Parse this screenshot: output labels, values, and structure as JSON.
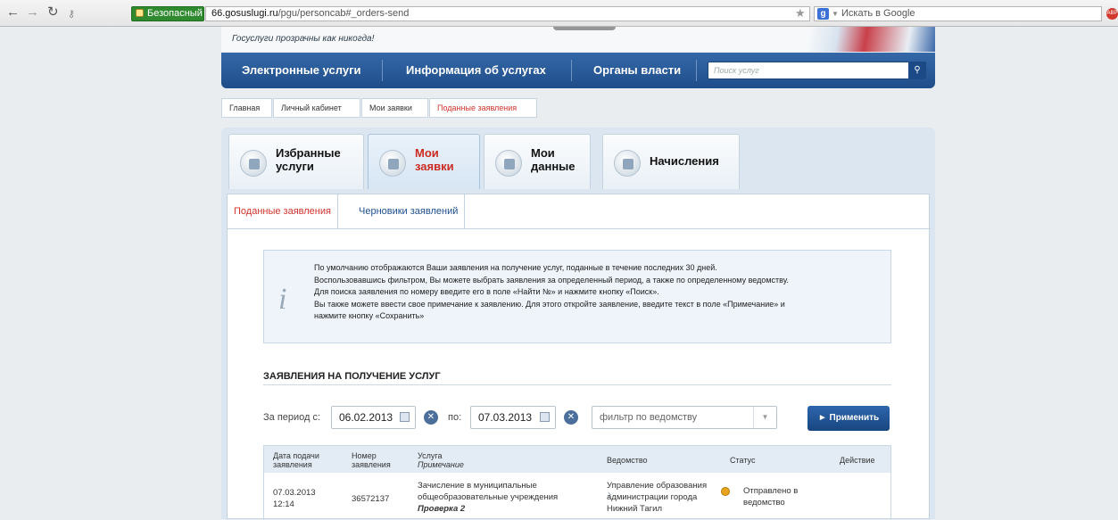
{
  "browser": {
    "security_label": "Безопасный",
    "url_domain": "66.gosuslugi.ru",
    "url_path": "/pgu/personcab#_orders-send",
    "search_placeholder": "Искать в Google",
    "search_engine_icon": "google-g-icon",
    "adblock_label": "ABP"
  },
  "site": {
    "slogan": "Госуслуги прозрачны как никогда!",
    "nav": [
      "Электронные услуги",
      "Информация об услугах",
      "Органы власти"
    ],
    "search_placeholder": "Поиск услуг",
    "breadcrumbs": [
      "Главная",
      "Личный кабинет",
      "Мои заявки",
      "Поданные заявления"
    ],
    "cabinet_tabs": [
      {
        "label": "Избранные услуги",
        "icon": "favorites-icon",
        "active": false
      },
      {
        "label": "Мои заявки",
        "icon": "orders-icon",
        "active": true
      },
      {
        "label": "Мои данные",
        "icon": "profile-data-icon",
        "active": false
      },
      {
        "label": "Начисления",
        "icon": "charges-icon",
        "active": false
      }
    ],
    "sub_tabs": [
      "Поданные заявления",
      "Черновики заявлений"
    ],
    "info_lines": [
      "По умолчанию отображаются Ваши заявления на получение услуг, поданные в течение последних 30 дней.",
      "Воспользовавшись фильтром, Вы можете выбрать заявления за определенный период, а также по определенному ведомству.",
      "Для поиска заявления по номеру введите его в поле «Найти №» и  нажмите кнопку «Поиск».",
      "Вы также можете ввести свое примечание к заявлению. Для этого откройте заявление, введите текст в поле «Примечание» и",
      "нажмите кнопку «Сохранить»"
    ],
    "section_title": "ЗАЯВЛЕНИЯ НА ПОЛУЧЕНИЕ УСЛУГ",
    "filter": {
      "period_from_label": "За период с:",
      "date_from": "06.02.2013",
      "to_label": "по:",
      "date_to": "07.03.2013",
      "dept_placeholder": "фильтр по ведомству",
      "apply_label": "► Применить"
    },
    "table": {
      "headers": {
        "date": "Дата подачи заявления",
        "number": "Номер заявления",
        "service": "Услуга",
        "note": "Примечание",
        "agency": "Ведомство",
        "status": "Статус",
        "action": "Действие"
      },
      "rows": [
        {
          "date": "07.03.2013 12:14",
          "number": "36572137",
          "service": "Зачисление в муниципальные общеобразовательные учреждения",
          "note": "Проверка 2",
          "agency": "Управление образования администрации города Нижний Тагил",
          "status": "Отправлено в ведомство",
          "status_color": "#e8a41c"
        }
      ]
    }
  }
}
